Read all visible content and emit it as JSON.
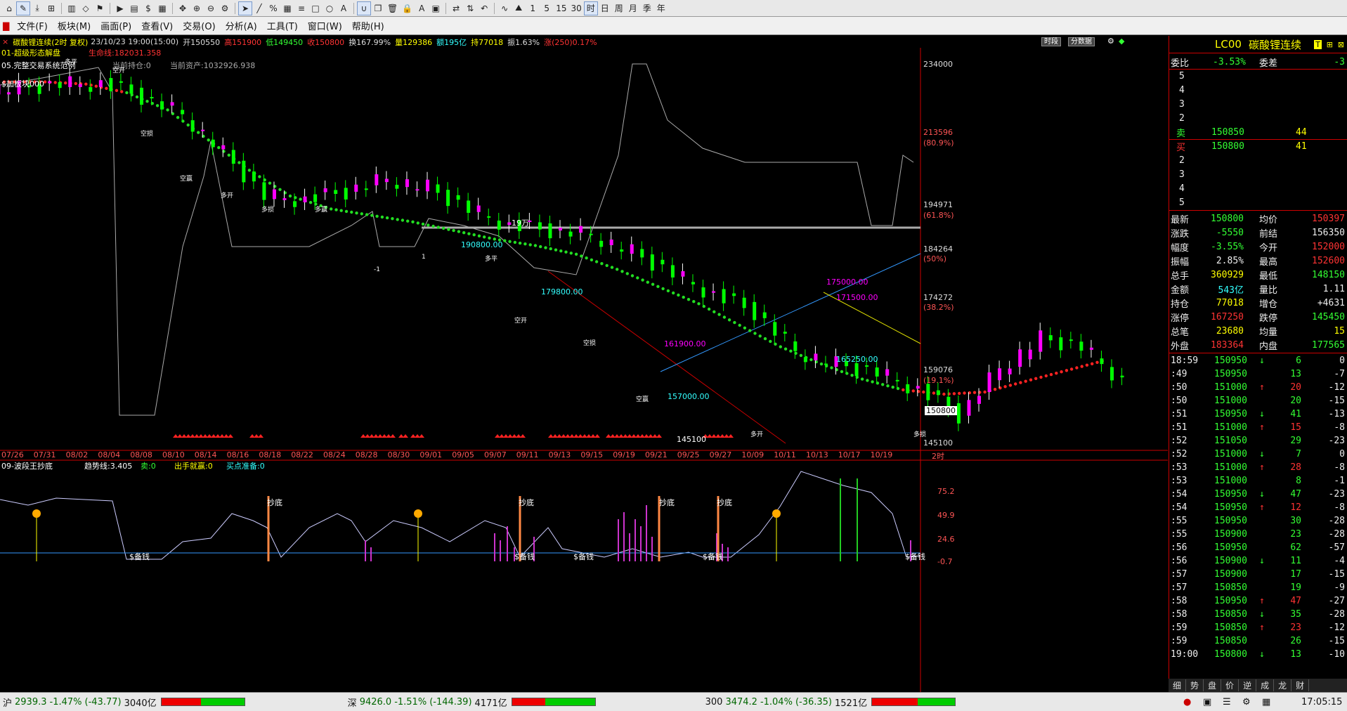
{
  "toolbar": {
    "periods": [
      "1",
      "5",
      "15",
      "30",
      "时",
      "日",
      "周",
      "月",
      "季",
      "年"
    ],
    "active_period": "时"
  },
  "menu": {
    "items": [
      "文件(F)",
      "板块(M)",
      "画面(P)",
      "查看(V)",
      "交易(O)",
      "分析(A)",
      "工具(T)",
      "窗口(W)",
      "帮助(H)"
    ]
  },
  "chart": {
    "title_prefix": "碳酸锂连续(2时 复权)",
    "date_text": "23/10/23 19:00(15:00)",
    "open_label": "开150550",
    "high_label": "高151900",
    "low_label": "低149450",
    "close_label": "收150800",
    "turnover_label": "换167.99%",
    "volume_label": "量129386",
    "amount_label": "额195亿",
    "position_label": "持77018",
    "amplitude_label": "振1.63%",
    "change_label": "涨(250)0.17%",
    "btn_period": "时段",
    "btn_data": "分数据",
    "indicator1_name": "01-超级形态解盘",
    "lifeline_label": "生命线:182031.358",
    "indicator2_name": "05.完整交易系统范例",
    "current_position": "当前持仓:0",
    "current_asset": "当前资产:1032926.938",
    "upper_left_label": "$加板块000",
    "annotations": [
      "19万",
      "190800.00",
      "179800.00",
      "161900.00",
      "157000.00",
      "175000.00",
      "171500.00",
      "165250.00",
      "145100"
    ],
    "yaxis": [
      "234000",
      "213596",
      "(80.9%)",
      "194971",
      "(61.8%)",
      "184264",
      "(50%)",
      "174272",
      "(38.2%)",
      "159076",
      "(19.1%)",
      "150800",
      "145100"
    ],
    "dates": [
      "07/26",
      "07/31",
      "08/02",
      "08/04",
      "08/08",
      "08/10",
      "08/14",
      "08/16",
      "08/18",
      "08/22",
      "08/24",
      "08/28",
      "08/30",
      "09/01",
      "09/05",
      "09/07",
      "09/11",
      "09/13",
      "09/15",
      "09/19",
      "09/21",
      "09/25",
      "09/27",
      "10/09",
      "10/11",
      "10/13",
      "10/17",
      "10/19"
    ],
    "date_axis_right": "2时",
    "candle_labels": [
      "多平",
      "空开",
      "空损",
      "空赢",
      "多开",
      "多损",
      "多赢",
      "-1",
      "1"
    ],
    "sub_name": "09-波段王抄底",
    "sub_trend": "趋势线:3.405",
    "sub_sell": "卖:0",
    "sub_out": "出手就赢:0",
    "sub_buy": "买点准备:0",
    "sub_axis": [
      "75.2",
      "49.9",
      "24.6",
      "-0.7"
    ],
    "sub_label_bottom": "抄底",
    "sub_label_money": "$备钱"
  },
  "chart_data": {
    "type": "candlestick",
    "title": "碳酸锂连续(2时 复权)",
    "unit": "price",
    "yrange": [
      145100,
      234000
    ],
    "x": [
      "07/26",
      "07/31",
      "08/02",
      "08/04",
      "08/08",
      "08/10",
      "08/14",
      "08/16",
      "08/18",
      "08/22",
      "08/24",
      "08/28",
      "08/30",
      "09/01",
      "09/05",
      "09/07",
      "09/11",
      "09/13",
      "09/15",
      "09/19",
      "09/21",
      "09/25",
      "09/27",
      "10/09",
      "10/11",
      "10/13",
      "10/17",
      "10/19"
    ],
    "close": [
      228000,
      229000,
      229000,
      226000,
      222000,
      213000,
      203000,
      202000,
      204000,
      207000,
      205000,
      200000,
      196000,
      195000,
      194000,
      190000,
      185000,
      180000,
      176000,
      167000,
      164000,
      162000,
      158000,
      152000,
      163000,
      170000,
      168000,
      160000
    ],
    "series": [
      {
        "name": "生命线",
        "values": [
          229500,
          229500,
          229000,
          227000,
          223000,
          216000,
          209000,
          203000,
          200000,
          198500,
          197000,
          195000,
          193000,
          191500,
          189500,
          186000,
          182000,
          178000,
          173000,
          168000,
          164000,
          160500,
          158000,
          157000,
          157500,
          160000,
          162500,
          165000
        ]
      }
    ],
    "ylabels": [
      "234000",
      "213596",
      "194971",
      "184264",
      "174272",
      "159076",
      "145100"
    ]
  },
  "right": {
    "contract_code": "LC00",
    "contract_name": "碳酸锂连续",
    "weibi_label": "委比",
    "weibi_val": "-3.53%",
    "weicha_label": "委差",
    "weicha_val": "-3",
    "ask_levels": [
      "5",
      "4",
      "3",
      "2"
    ],
    "ask1_label": "卖",
    "ask1_price": "150850",
    "ask1_vol": "44",
    "bid1_label": "买",
    "bid1_price": "150800",
    "bid1_vol": "41",
    "bid_levels": [
      "2",
      "3",
      "4",
      "5"
    ],
    "stats": [
      [
        "最新",
        "150800",
        "均价",
        "150397"
      ],
      [
        "涨跌",
        "-5550",
        "前结",
        "156350"
      ],
      [
        "幅度",
        "-3.55%",
        "今开",
        "152000"
      ],
      [
        "振幅",
        "2.85%",
        "最高",
        "152600"
      ],
      [
        "总手",
        "360929",
        "最低",
        "148150"
      ],
      [
        "金额",
        "543亿",
        "量比",
        "1.11"
      ],
      [
        "持仓",
        "77018",
        "增仓",
        "+4631"
      ],
      [
        "涨停",
        "167250",
        "跌停",
        "145450"
      ],
      [
        "总笔",
        "23680",
        "均量",
        "15"
      ],
      [
        "外盘",
        "183364",
        "内盘",
        "177565"
      ]
    ],
    "ticks": [
      [
        "18:59",
        "150950",
        "↓",
        "6",
        "0"
      ],
      [
        ":49",
        "150950",
        "",
        "13",
        "-7"
      ],
      [
        ":50",
        "151000",
        "↑",
        "20",
        "-12"
      ],
      [
        ":50",
        "151000",
        "",
        "20",
        "-15"
      ],
      [
        ":51",
        "150950",
        "↓",
        "41",
        "-13"
      ],
      [
        ":51",
        "151000",
        "↑",
        "15",
        "-8"
      ],
      [
        ":52",
        "151050",
        "",
        "29",
        "-23"
      ],
      [
        ":52",
        "151000",
        "↓",
        "7",
        "0"
      ],
      [
        ":53",
        "151000",
        "↑",
        "28",
        "-8"
      ],
      [
        ":53",
        "151000",
        "",
        "8",
        "-1"
      ],
      [
        ":54",
        "150950",
        "↓",
        "47",
        "-23"
      ],
      [
        ":54",
        "150950",
        "↑",
        "12",
        "-8"
      ],
      [
        ":55",
        "150950",
        "",
        "30",
        "-28"
      ],
      [
        ":55",
        "150900",
        "",
        "23",
        "-28"
      ],
      [
        ":56",
        "150950",
        "",
        "62",
        "-57"
      ],
      [
        ":56",
        "150900",
        "↓",
        "11",
        "-4"
      ],
      [
        ":57",
        "150900",
        "",
        "17",
        "-15"
      ],
      [
        ":57",
        "150850",
        "",
        "19",
        "-9"
      ],
      [
        ":58",
        "150950",
        "↑",
        "47",
        "-27"
      ],
      [
        ":58",
        "150850",
        "↓",
        "35",
        "-28"
      ],
      [
        ":59",
        "150850",
        "↑",
        "23",
        "-12"
      ],
      [
        ":59",
        "150850",
        "",
        "26",
        "-15"
      ],
      [
        "19:00",
        "150800",
        "↓",
        "13",
        "-10"
      ]
    ],
    "tabs": [
      "细",
      "势",
      "盘",
      "价",
      "逆",
      "成",
      "龙",
      "财"
    ]
  },
  "status": {
    "sh_label": "沪",
    "sh_val": "2939.3",
    "sh_chg": "-1.47%",
    "sh_pts": "(-43.77)",
    "sh_amt": "3040亿",
    "sz_label": "深",
    "sz_val": "9426.0",
    "sz_chg": "-1.51%",
    "sz_pts": "(-144.39)",
    "sz_amt": "4171亿",
    "c300_label": "300",
    "c300_val": "3474.2",
    "c300_chg": "-1.04%",
    "c300_pts": "(-36.35)",
    "c300_amt": "1521亿",
    "time": "17:05:15"
  }
}
